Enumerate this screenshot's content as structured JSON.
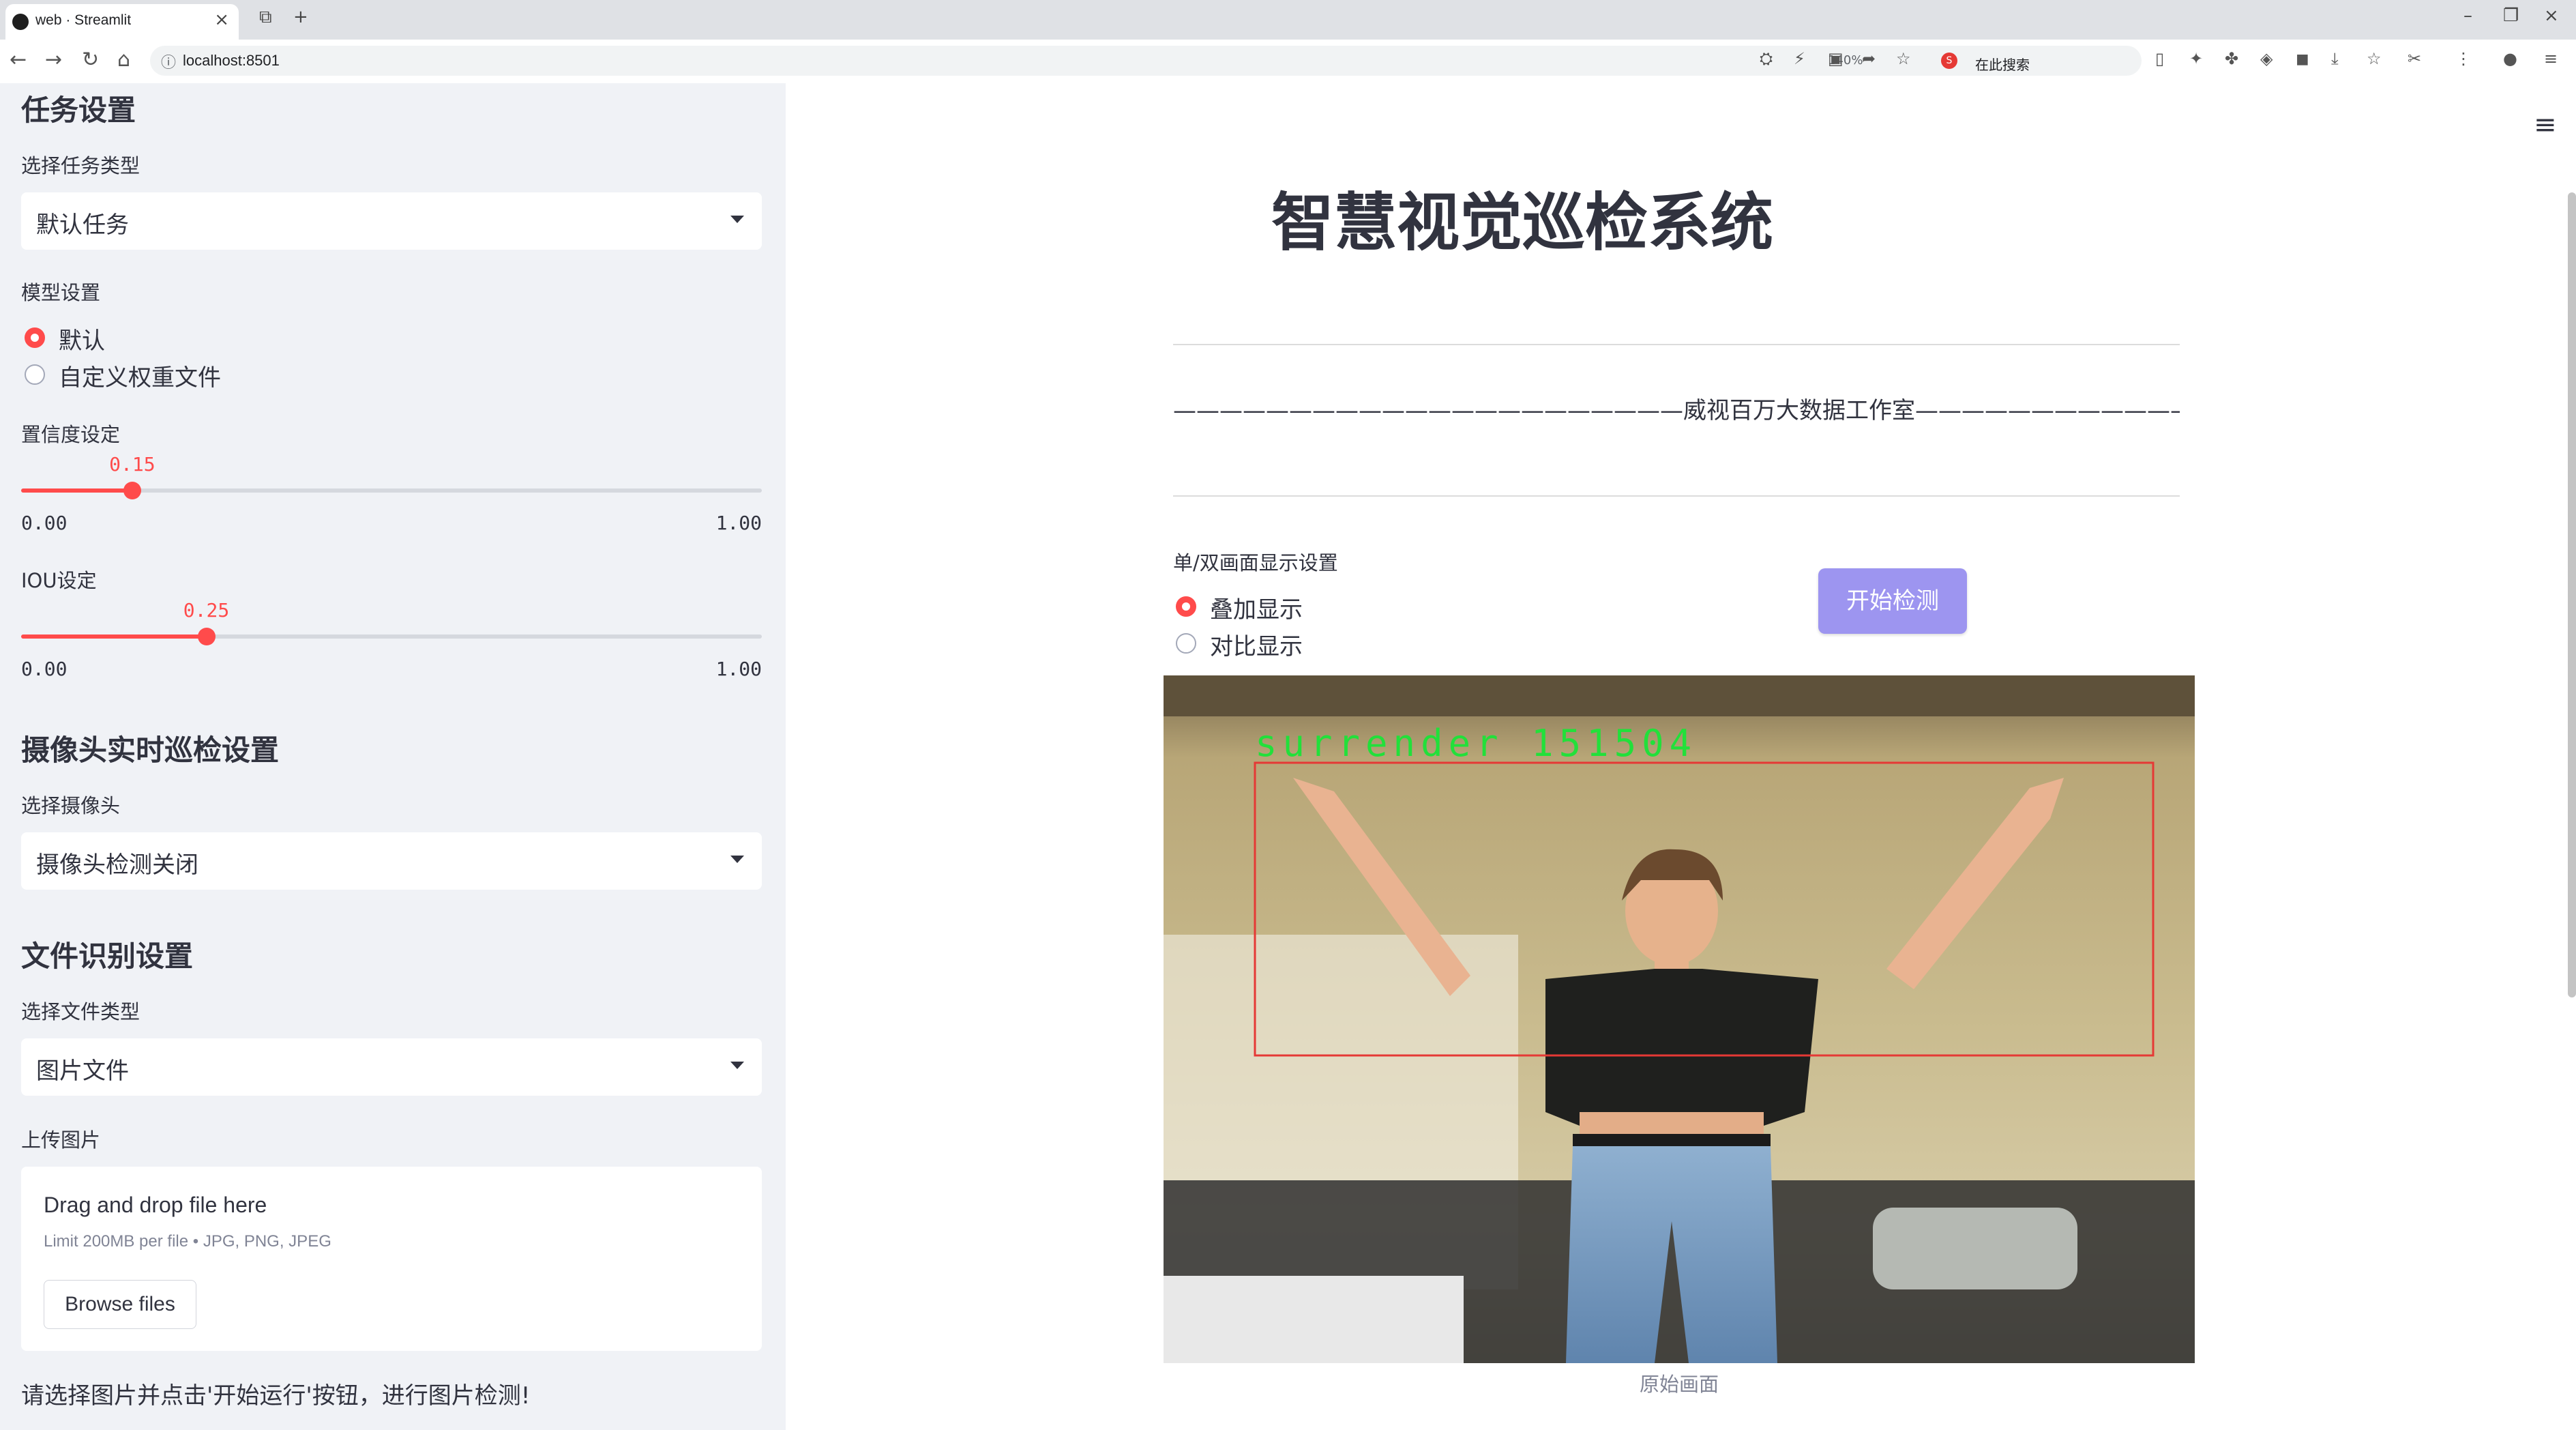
{
  "browser": {
    "tab_title": "web · Streamlit",
    "url": "localhost:8501",
    "zoom": "140%",
    "search_placeholder": "在此搜索"
  },
  "sidebar": {
    "task_header": "任务设置",
    "task_type_label": "选择任务类型",
    "task_type_value": "默认任务",
    "model_label": "模型设置",
    "model_options": [
      "默认",
      "自定义权重文件"
    ],
    "model_selected": 0,
    "conf_label": "置信度设定",
    "conf_value": "0.15",
    "conf_fraction": 0.15,
    "conf_min": "0.00",
    "conf_max": "1.00",
    "iou_label": "IOU设定",
    "iou_value": "0.25",
    "iou_fraction": 0.25,
    "iou_min": "0.00",
    "iou_max": "1.00",
    "camera_header": "摄像头实时巡检设置",
    "camera_label": "选择摄像头",
    "camera_value": "摄像头检测关闭",
    "file_header": "文件识别设置",
    "file_type_label": "选择文件类型",
    "file_type_value": "图片文件",
    "upload_label": "上传图片",
    "upload_title": "Drag and drop file here",
    "upload_limit": "Limit 200MB per file • JPG, PNG, JPEG",
    "browse_label": "Browse files",
    "note": "请选择图片并点击'开始运行'按钮，进行图片检测!"
  },
  "main": {
    "title": "智慧视觉巡检系统",
    "subtitle": "——————————————————————威视百万大数据工作室——————————————————————",
    "display_label": "单/双画面显示设置",
    "display_options": [
      "叠加显示",
      "对比显示"
    ],
    "display_selected": 0,
    "start_button": "开始检测",
    "detection_label": "surrender 151504",
    "caption": "原始画面"
  },
  "colors": {
    "accent": "#ff4b4b",
    "button": "#9d95f0",
    "sidebar_bg": "#f0f2f6",
    "detection_box": "#e53935",
    "detection_text": "#22e03a"
  }
}
